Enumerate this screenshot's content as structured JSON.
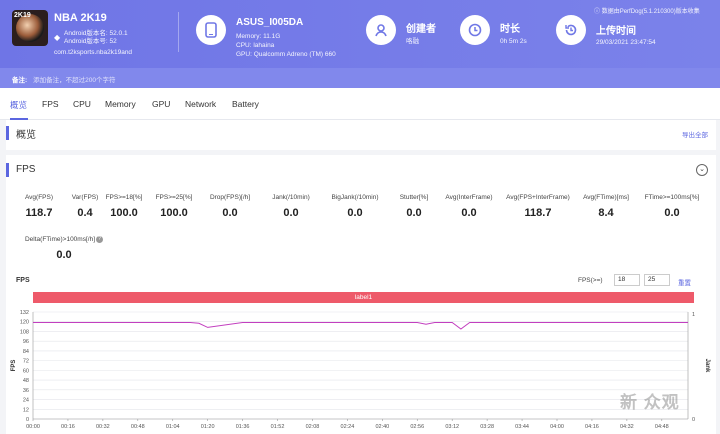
{
  "app": {
    "icon_text": "2K19",
    "name": "NBA 2K19",
    "android_version": "Android版本名: 52.0.1",
    "android_code": "Android版本号: 52",
    "package": "com.t2ksports.nba2k19and"
  },
  "device": {
    "name": "ASUS_I005DA",
    "memory": "Memory: 11.1G",
    "cpu": "CPU: lahaina",
    "gpu": "GPU: Qualcomm Adreno (TM) 660"
  },
  "creator": {
    "title": "创建者",
    "value": "咯融"
  },
  "duration": {
    "title": "时长",
    "value": "0h 5m 2s"
  },
  "upload": {
    "title": "上传时间",
    "value": "29/03/2021 23:47:54"
  },
  "perfdog_note": "数据由PerfDog(5.1.210300)版本收集",
  "note": {
    "label": "备注:",
    "placeholder": "添加备注，不超过200个字符"
  },
  "tabs": [
    "概览",
    "FPS",
    "CPU",
    "Memory",
    "GPU",
    "Network",
    "Battery"
  ],
  "overview": {
    "title": "概览",
    "export": "导出全部"
  },
  "fps_section": {
    "title": "FPS",
    "metrics": [
      {
        "label": "Avg(FPS)",
        "value": "118.7"
      },
      {
        "label": "Var(FPS)",
        "value": "0.4"
      },
      {
        "label": "FPS>=18[%]",
        "value": "100.0"
      },
      {
        "label": "FPS>=25[%]",
        "value": "100.0"
      },
      {
        "label": "Drop(FPS)[/h]",
        "value": "0.0"
      },
      {
        "label": "Jank(/10min)",
        "value": "0.0"
      },
      {
        "label": "BigJank(/10min)",
        "value": "0.0"
      },
      {
        "label": "Stutter[%]",
        "value": "0.0"
      },
      {
        "label": "Avg(InterFrame)",
        "value": "0.0"
      },
      {
        "label": "Avg(FPS+InterFrame)",
        "value": "118.7"
      },
      {
        "label": "Avg(FTime)[ms]",
        "value": "8.4"
      },
      {
        "label": "FTime>=100ms[%]",
        "value": "0.0"
      },
      {
        "label": "Delta(FTime)>100ms[/h]",
        "value": "0.0"
      }
    ],
    "chart_title": "FPS",
    "filter_label": "FPS(>=)",
    "filter_values": [
      "18",
      "25"
    ],
    "reset": "重置",
    "label_bar": "label1",
    "y_axis_label": "FPS",
    "right_axis_label": "Jank"
  },
  "chart_data": {
    "type": "line",
    "ylabel": "FPS",
    "ylim": [
      0,
      132
    ],
    "y_ticks": [
      0,
      12,
      24,
      36,
      48,
      60,
      72,
      84,
      96,
      108,
      120,
      132
    ],
    "right_ticks": [
      "1",
      "0"
    ],
    "x_ticks": [
      "00:00",
      "00:16",
      "00:32",
      "00:48",
      "01:04",
      "01:20",
      "01:36",
      "01:52",
      "02:08",
      "02:24",
      "02:40",
      "02:56",
      "03:12",
      "03:28",
      "03:44",
      "04:00",
      "04:16",
      "04:32",
      "04:48"
    ],
    "series": [
      {
        "color": "#c23fbf",
        "x": [
          "00:00",
          "00:16",
          "00:32",
          "00:48",
          "01:04",
          "01:12",
          "01:16",
          "01:20",
          "01:36",
          "01:52",
          "02:08",
          "02:24",
          "02:40",
          "02:56",
          "03:00",
          "03:04",
          "03:12",
          "03:16",
          "03:20",
          "03:28",
          "03:44",
          "04:00",
          "04:16",
          "04:32",
          "04:48",
          "05:00"
        ],
        "values": [
          119,
          119,
          119,
          119,
          119,
          119,
          118,
          113,
          119,
          119,
          119,
          119,
          119,
          119,
          117,
          119,
          119,
          111,
          119,
          119,
          119,
          119,
          119,
          119,
          119,
          119
        ]
      }
    ]
  },
  "watermark": "新 众观"
}
